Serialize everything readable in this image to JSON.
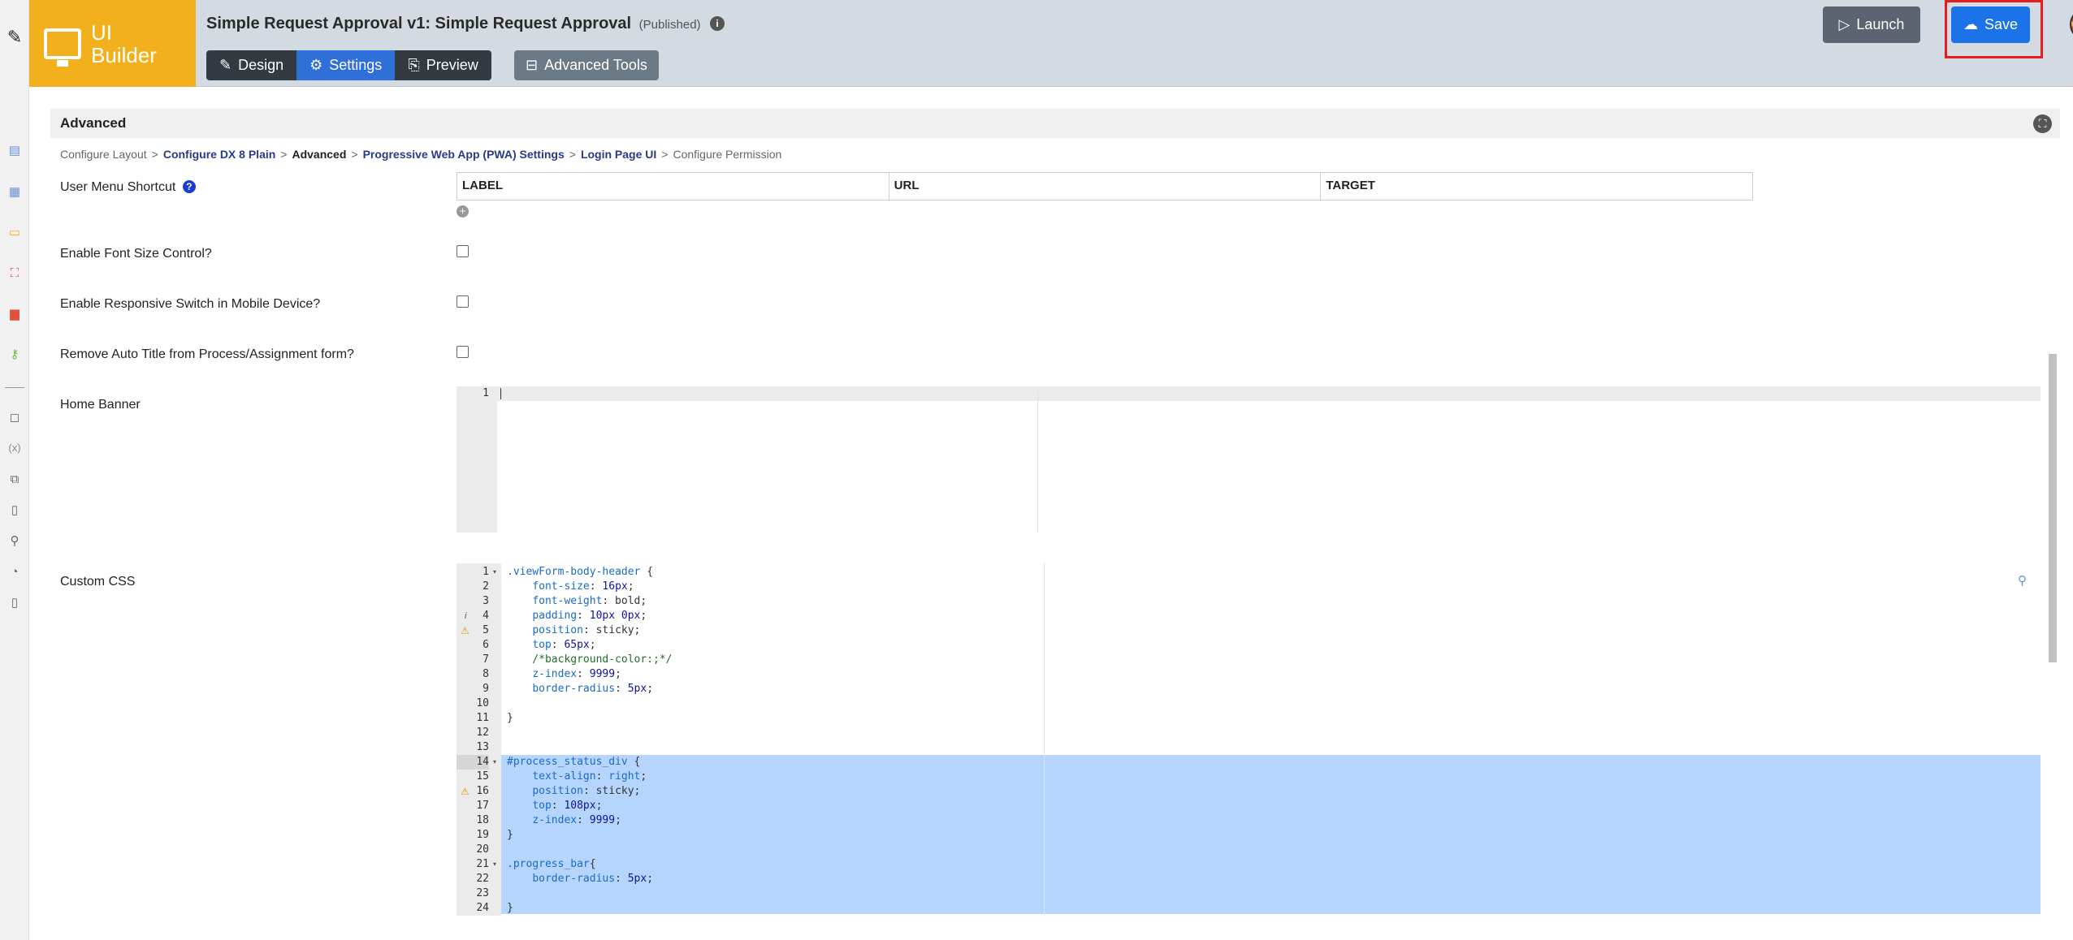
{
  "header": {
    "logo_text": "UI Builder",
    "app_title": "Simple Request Approval v1: Simple Request Approval",
    "status": "(Published)",
    "info_glyph": "i",
    "tabs": [
      {
        "label": "Design",
        "icon": "pencil-ruler-icon"
      },
      {
        "label": "Settings",
        "icon": "gear-icon",
        "active": true
      },
      {
        "label": "Preview",
        "icon": "document-search-icon"
      }
    ],
    "advanced_tools": "Advanced Tools",
    "launch": "Launch",
    "save": "Save",
    "brand_color": "#f3b01d",
    "save_color": "#1a73e8",
    "highlight_color": "#e32020"
  },
  "rail": {
    "icons": [
      "edit-icon",
      "page-icon",
      "table-icon",
      "monitor-icon",
      "hierarchy-icon",
      "pdf-icon",
      "key-icon",
      "note-icon",
      "variable-icon",
      "copy-icon",
      "doc-gear-icon",
      "plugin-icon",
      "gauge-icon",
      "form-icon"
    ]
  },
  "panel": {
    "title": "Advanced",
    "breadcrumb": [
      {
        "text": "Configure Layout",
        "type": "plain"
      },
      {
        "text": "Configure DX 8 Plain",
        "type": "link"
      },
      {
        "text": "Advanced",
        "type": "current"
      },
      {
        "text": "Progressive Web App (PWA) Settings",
        "type": "link"
      },
      {
        "text": "Login Page UI",
        "type": "link"
      },
      {
        "text": "Configure Permission",
        "type": "plain"
      }
    ],
    "breadcrumb_sep": ">"
  },
  "fields": {
    "user_menu_shortcut": "User Menu Shortcut",
    "help_glyph": "?",
    "columns": [
      "LABEL",
      "URL",
      "TARGET"
    ],
    "add_glyph": "+",
    "font_size_control": "Enable Font Size Control?",
    "responsive_switch": "Enable Responsive Switch in Mobile Device?",
    "remove_auto_title": "Remove Auto Title from Process/Assignment form?",
    "home_banner": "Home Banner",
    "custom_css": "Custom CSS",
    "checkboxes": {
      "font_size_control": false,
      "responsive_switch": false,
      "remove_auto_title": false
    }
  },
  "home_banner_editor": {
    "lines": [
      "1"
    ]
  },
  "css_editor": {
    "line_numbers": [
      "1",
      "2",
      "3",
      "4",
      "5",
      "6",
      "7",
      "8",
      "9",
      "10",
      "11",
      "12",
      "13",
      "14",
      "15",
      "16",
      "17",
      "18",
      "19",
      "20",
      "21",
      "22",
      "23",
      "24"
    ],
    "lines": [
      ".viewForm-body-header {",
      "    font-size: 16px;",
      "    font-weight: bold;",
      "    padding: 10px 0px;",
      "    position: sticky;",
      "    top: 65px;",
      "    /*background-color:;*/",
      "    z-index: 9999;",
      "    border-radius: 5px;",
      "",
      "}",
      "",
      "",
      "#process_status_div {",
      "    text-align: right;",
      "    position: sticky;",
      "    top: 108px;",
      "    z-index: 9999;",
      "}",
      "",
      ".progress_bar{",
      "    border-radius: 5px;",
      "",
      "}"
    ],
    "selected_lines": "14-24",
    "fold_markers": [
      1,
      14,
      21
    ],
    "info_marker_line": 4,
    "warning_marker_lines": [
      5,
      16
    ]
  }
}
